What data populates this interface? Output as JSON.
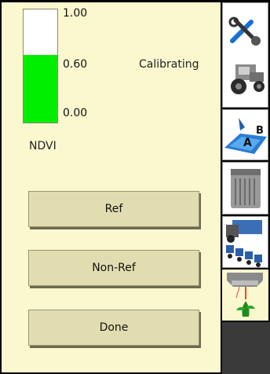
{
  "gauge": {
    "label": "NDVI",
    "ticks": [
      "1.00",
      "0.60",
      "0.00"
    ],
    "value": 0.6,
    "fill_color": "#00ee00"
  },
  "status": "Calibrating",
  "buttons": {
    "ref": "Ref",
    "non_ref": "Non-Ref",
    "done": "Done"
  },
  "toolbar": {
    "items": [
      {
        "icon": "settings-tractor-icon"
      },
      {
        "icon": "ab-line-icon",
        "text": "AB"
      },
      {
        "icon": "implement-icon"
      },
      {
        "icon": "seeder-icon"
      },
      {
        "icon": "crop-sensor-icon"
      }
    ],
    "ab_letters": {
      "a": "A",
      "b": "B"
    }
  }
}
